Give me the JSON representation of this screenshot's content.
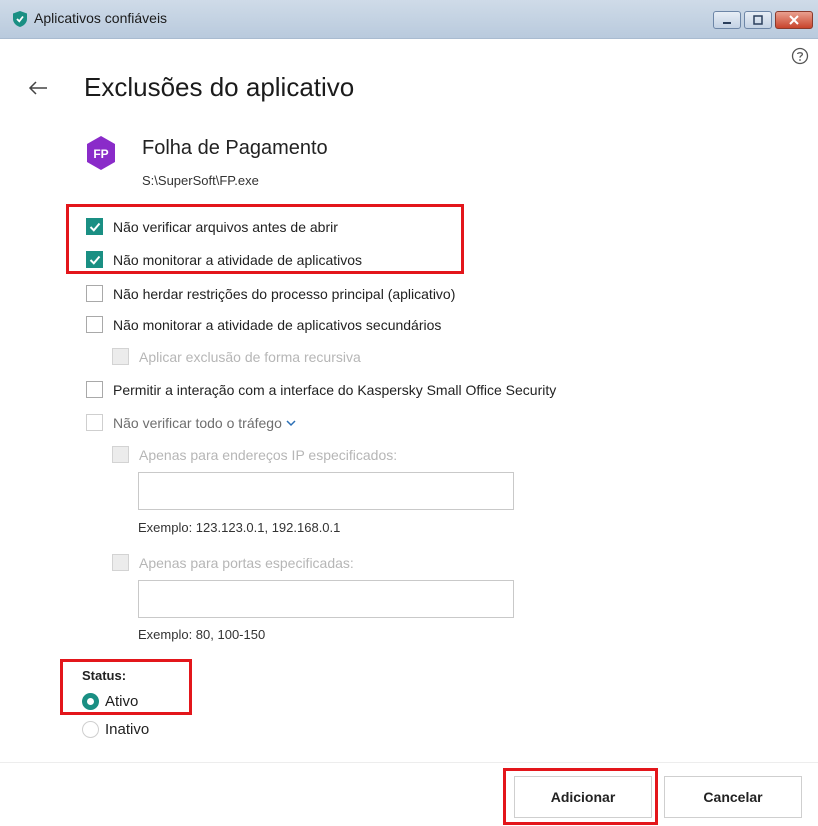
{
  "window": {
    "title": "Aplicativos confiáveis"
  },
  "page": {
    "title": "Exclusões do aplicativo"
  },
  "app": {
    "badge": "FP",
    "name": "Folha de Pagamento",
    "path": "S:\\SuperSoft\\FP.exe"
  },
  "options": [
    {
      "label": "Não verificar arquivos antes de abrir",
      "checked": true,
      "enabled": true
    },
    {
      "label": "Não monitorar a atividade de aplicativos",
      "checked": true,
      "enabled": true
    },
    {
      "label": "Não herdar restrições do processo principal (aplicativo)",
      "checked": false,
      "enabled": true
    },
    {
      "label": "Não monitorar a atividade de aplicativos secundários",
      "checked": false,
      "enabled": true
    },
    {
      "label": "Aplicar exclusão de forma recursiva",
      "checked": false,
      "enabled": false
    },
    {
      "label": "Permitir a interação com a interface do Kaspersky Small Office Security",
      "checked": false,
      "enabled": true
    },
    {
      "label": "Não verificar todo o tráfego",
      "checked": false,
      "enabled": true
    },
    {
      "label": "Apenas para endereços IP especificados:",
      "checked": false,
      "enabled": false
    },
    {
      "label": "Apenas para portas especificadas:",
      "checked": false,
      "enabled": false
    }
  ],
  "ip_field": {
    "value": "",
    "example": "Exemplo: 123.123.0.1, 192.168.0.1"
  },
  "port_field": {
    "value": "",
    "example": "Exemplo: 80, 100-150"
  },
  "status": {
    "label": "Status:",
    "options": [
      "Ativo",
      "Inativo"
    ],
    "selected": "Ativo"
  },
  "buttons": {
    "add": "Adicionar",
    "cancel": "Cancelar"
  },
  "colors": {
    "accent": "#1a8f83",
    "highlight": "#e3161b",
    "app_badge": "#8a2bc9"
  }
}
